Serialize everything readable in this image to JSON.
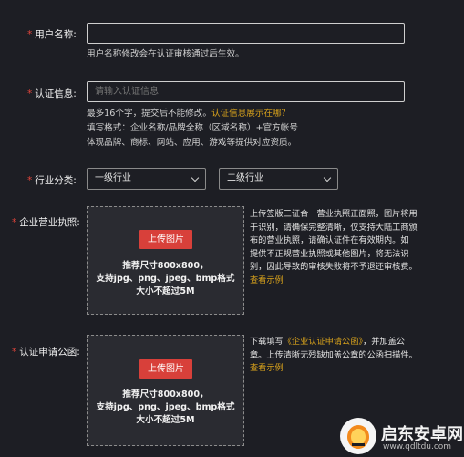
{
  "form": {
    "username": {
      "required_mark": "*",
      "label": "用户名称:",
      "value": "",
      "hint": "用户名称修改会在认证审核通过后生效。"
    },
    "cert_info": {
      "required_mark": "*",
      "label": "认证信息:",
      "placeholder": "请输入认证信息",
      "hint_line1": "最多16个字，提交后不能修改。",
      "hint_link": "认证信息展示在哪？",
      "hint_line2": "填写格式：企业名称/品牌全称（区域名称）+官方帐号",
      "hint_line3": "体现品牌、商标、网站、应用、游戏等提供对应资质。"
    },
    "industry": {
      "required_mark": "*",
      "label": "行业分类:",
      "primary_selected": "一级行业",
      "secondary_selected": "二级行业"
    },
    "license": {
      "required_mark": "*",
      "label": "企业营业执照:",
      "upload_button": "上传图片",
      "upload_note_1": "推荐尺寸800x800，",
      "upload_note_2": "支持jpg、png、jpeg、bmp格式",
      "upload_note_3": "大小不超过5M",
      "desc_1": "上传签版三证合一营业执照正面照，图片将用",
      "desc_2": "于识别，请确保完整清晰，仅支持大陆工商颁",
      "desc_3": "布的营业执照，请确认证件在有效期内。如",
      "desc_4": "提供不正规营业执照或其他图片，将无法识",
      "desc_5": "别，因此导致的审核失败将不予退还审核费。",
      "example_link": "查看示例"
    },
    "application_letter": {
      "required_mark": "*",
      "label": "认证申请公函:",
      "upload_button": "上传图片",
      "upload_note_1": "推荐尺寸800x800，",
      "upload_note_2": "支持jpg、png、jpeg、bmp格式",
      "upload_note_3": "大小不超过5M",
      "desc_prefix": "下载填写",
      "desc_link": "《企业认证申请公函》",
      "desc_suffix": "，并加盖公",
      "desc_2": "章。上传清晰无残缺加盖公章的公函扫描件。",
      "example_link": "查看示例"
    }
  },
  "watermark": {
    "title": "启东安卓网",
    "url": "www.qdltdu.com"
  },
  "colors": {
    "background": "#1d1e24",
    "required": "#e3453b",
    "link": "#d8a21c",
    "upload_button": "#d8403a"
  }
}
